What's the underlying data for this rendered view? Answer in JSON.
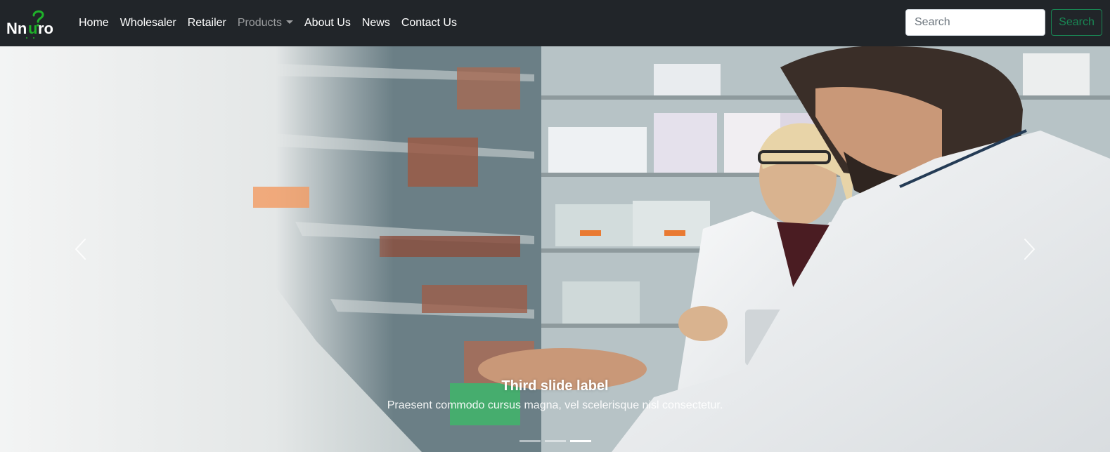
{
  "brand": {
    "name": "Nnuro",
    "accent_color": "#1fb22a"
  },
  "nav": {
    "items": [
      {
        "label": "Home"
      },
      {
        "label": "Wholesaler"
      },
      {
        "label": "Retailer"
      },
      {
        "label": "Products",
        "dropdown": true
      },
      {
        "label": "About Us"
      },
      {
        "label": "News"
      },
      {
        "label": "Contact Us"
      }
    ]
  },
  "search": {
    "placeholder": "Search",
    "button_label": "Search",
    "button_color": "#198754"
  },
  "carousel": {
    "caption_title": "Third slide label",
    "caption_text": "Praesent commodo cursus magna, vel scelerisque nisl consectetur.",
    "prev_icon": "chevron-left-icon",
    "next_icon": "chevron-right-icon",
    "indicator_count": 3,
    "active_indicator": 3
  }
}
